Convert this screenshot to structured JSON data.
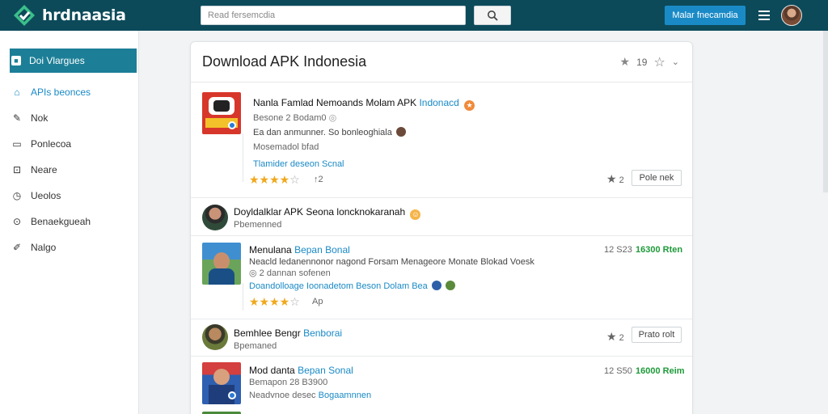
{
  "header": {
    "brand": "hrdnaasia",
    "search_placeholder": "Read fersemcdia",
    "cta_label": "Malar fnecamdia"
  },
  "colors": {
    "header_bg": "#0c4a5a",
    "accent": "#1a8ac6",
    "sidebar_active": "#1c7f97",
    "star": "#f0a81c",
    "price_green": "#1e9a3a"
  },
  "sidebar": {
    "items": [
      {
        "label": "Doi Vlargues",
        "icon": "square-icon",
        "active": true
      },
      {
        "label": "APIs beonces",
        "icon": "home-icon"
      },
      {
        "label": "Nok",
        "icon": "edit-icon"
      },
      {
        "label": "Ponlecoa",
        "icon": "window-icon"
      },
      {
        "label": "Neare",
        "icon": "bookmark-icon"
      },
      {
        "label": "Ueolos",
        "icon": "clock-icon"
      },
      {
        "label": "Benaekgueah",
        "icon": "settings-icon"
      },
      {
        "label": "Nalgo",
        "icon": "tool-icon"
      }
    ]
  },
  "card": {
    "title": "Download APK Indonesia",
    "rating_text": "19",
    "entries": {
      "e1": {
        "title": "Nanla Famlad Nemoands Molam APK",
        "title_link": "Indonacd",
        "meta": "Besone 2 Bodam0",
        "desc": "Ea dan anmunner. So bonleoghiala",
        "sub": "Mosemadol bfad",
        "link": "Tlamider deseon Scnal",
        "rating": 3.5,
        "count": "2",
        "button": "Pole nek"
      },
      "e2": {
        "title": "Doyldalklar APK Seona loncknokaranah",
        "sub": "Pbemenned"
      },
      "e3": {
        "title": "Menulana",
        "title_link": "Bepan Bonal",
        "meta_right": "12 S23",
        "price": "16300 Rten",
        "desc": "Neacld ledanennonor nagond Forsam Menageore Monate Blokad Voesk",
        "meta": "2 dannan sofenen",
        "tags": "Doandolloage Ioonadetom Beson Dolam Bea",
        "rating": 3.5,
        "count": "Ap"
      },
      "e4": {
        "title": "Bemhlee Bengr",
        "title_link": "Benborai",
        "sub": "Bpemaned",
        "count": "2",
        "button": "Prato rolt"
      },
      "e5": {
        "title": "Mod danta",
        "title_link": "Bepan Sonal",
        "meta_right": "12 S50",
        "price": "16000 Reim",
        "meta": "Bemapon 28 B3900",
        "desc": "Neadvnoe desec",
        "desc_link": "Bogaamnnen"
      }
    }
  }
}
